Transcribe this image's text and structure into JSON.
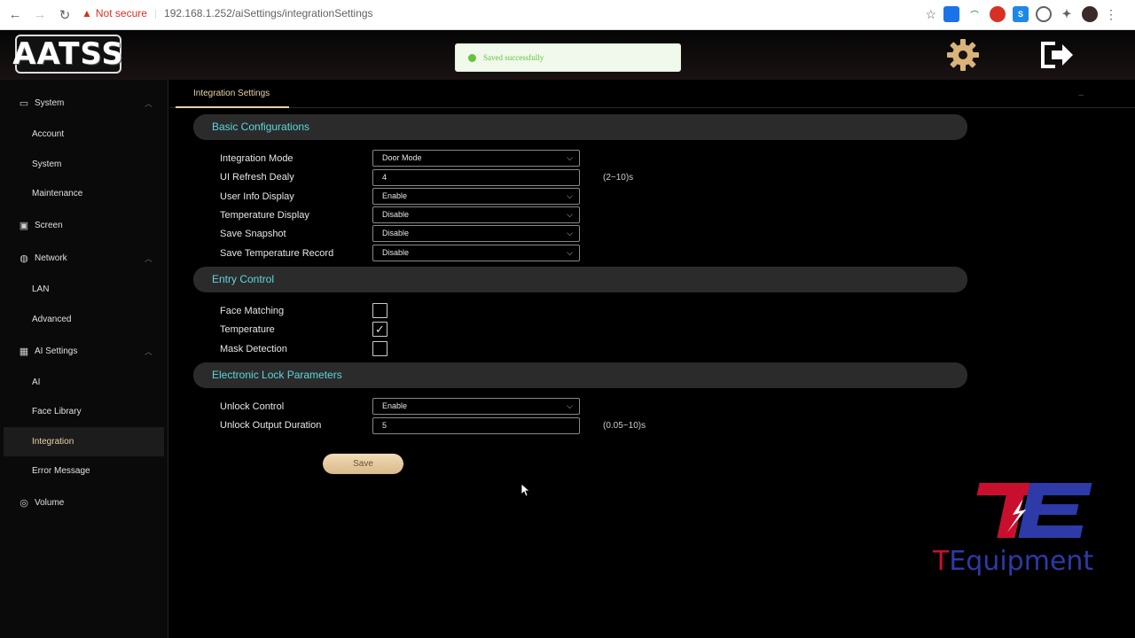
{
  "browser": {
    "not_secure": "Not secure",
    "url": "192.168.1.252/aiSettings/integrationSettings"
  },
  "header": {
    "logo_text": "AATSS",
    "toast": "Saved successfully"
  },
  "sidebar": {
    "items": [
      {
        "label": "System",
        "icon": "monitor-icon"
      },
      {
        "label": "Account"
      },
      {
        "label": "System"
      },
      {
        "label": "Maintenance"
      },
      {
        "label": "Screen",
        "icon": "image-icon"
      },
      {
        "label": "Network",
        "icon": "globe-icon"
      },
      {
        "label": "LAN"
      },
      {
        "label": "Advanced"
      },
      {
        "label": "AI Settings",
        "icon": "chip-icon"
      },
      {
        "label": "AI"
      },
      {
        "label": "Face Library"
      },
      {
        "label": "Integration"
      },
      {
        "label": "Error Message"
      },
      {
        "label": "Volume",
        "icon": "volume-icon"
      }
    ]
  },
  "tabs": {
    "active": "Integration Settings",
    "collapse": "–"
  },
  "basic": {
    "title": "Basic Configurations",
    "integration_mode": {
      "label": "Integration Mode",
      "value": "Door Mode"
    },
    "ui_refresh": {
      "label": "UI Refresh Dealy",
      "value": "4",
      "hint": "(2~10)s"
    },
    "user_info": {
      "label": "User Info Display",
      "value": "Enable"
    },
    "temp_display": {
      "label": "Temperature Display",
      "value": "Disable"
    },
    "save_snapshot": {
      "label": "Save Snapshot",
      "value": "Disable"
    },
    "save_temp_record": {
      "label": "Save Temperature Record",
      "value": "Disable"
    }
  },
  "entry": {
    "title": "Entry Control",
    "face_matching": {
      "label": "Face Matching",
      "checked": false
    },
    "temperature": {
      "label": "Temperature",
      "checked": true
    },
    "mask_detection": {
      "label": "Mask Detection",
      "checked": false
    }
  },
  "lock": {
    "title": "Electronic Lock Parameters",
    "unlock_control": {
      "label": "Unlock Control",
      "value": "Enable"
    },
    "unlock_duration": {
      "label": "Unlock Output Duration",
      "value": "5",
      "hint": "(0.05~10)s"
    }
  },
  "save_label": "Save",
  "watermark": {
    "text": "TEquipment",
    "colors": {
      "red": "#c8102e",
      "blue": "#2d3aa8"
    }
  }
}
